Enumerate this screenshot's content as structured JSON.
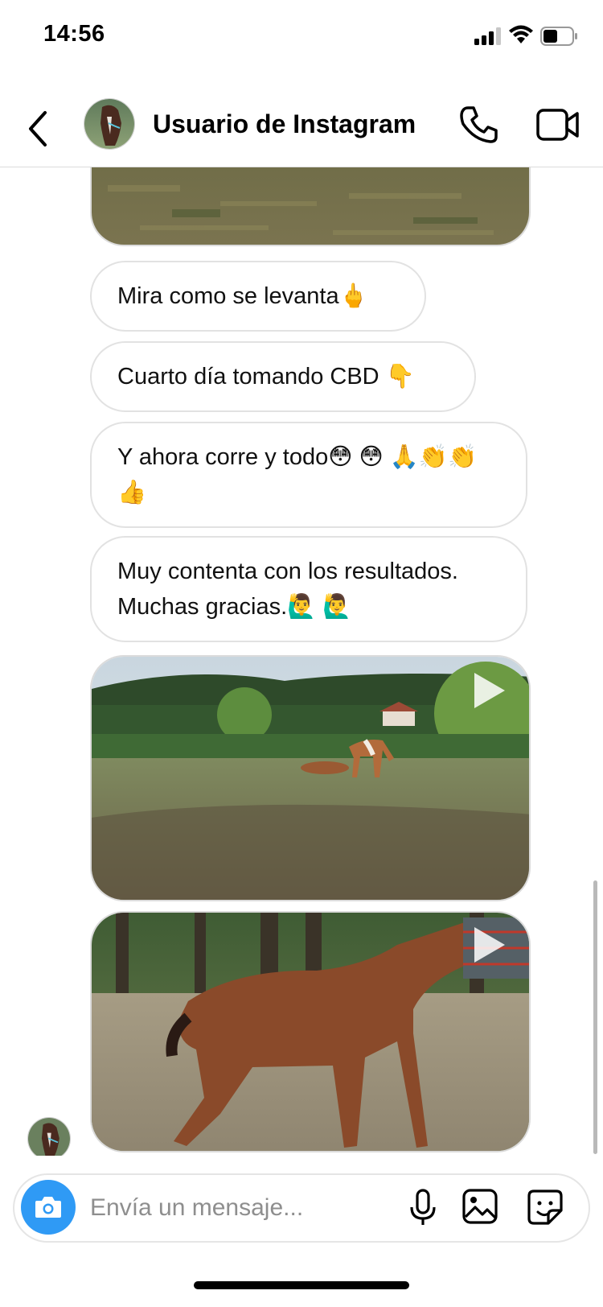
{
  "status_bar": {
    "time": "14:56"
  },
  "header": {
    "contact_name": "Usuario de Instagram",
    "icons": [
      "chevron-left-icon",
      "phone-icon",
      "video-camera-icon"
    ]
  },
  "messages": [
    {
      "type": "image",
      "description_icon": "photo"
    },
    {
      "type": "text",
      "text": "Mira como se levanta🖕"
    },
    {
      "type": "text",
      "text": "Cuarto día tomando CBD 👇"
    },
    {
      "type": "text",
      "text": "Y ahora corre y todo😳 😳 🙏👏👏👍"
    },
    {
      "type": "text",
      "text": "Muy contenta con los resultados. Muchas gracias.🙋‍♂️ 🙋‍♂️"
    },
    {
      "type": "video",
      "icon": "play-icon"
    },
    {
      "type": "video",
      "icon": "play-icon"
    }
  ],
  "composer": {
    "placeholder": "Envía un mensaje...",
    "value": "",
    "icons": [
      "camera-icon",
      "microphone-icon",
      "gallery-icon",
      "sticker-icon"
    ]
  },
  "colors": {
    "accent_blue": "#2f9af5",
    "bubble_border": "#e2e2e2",
    "divider": "#dbdbdb",
    "placeholder": "#8e8e8e"
  }
}
